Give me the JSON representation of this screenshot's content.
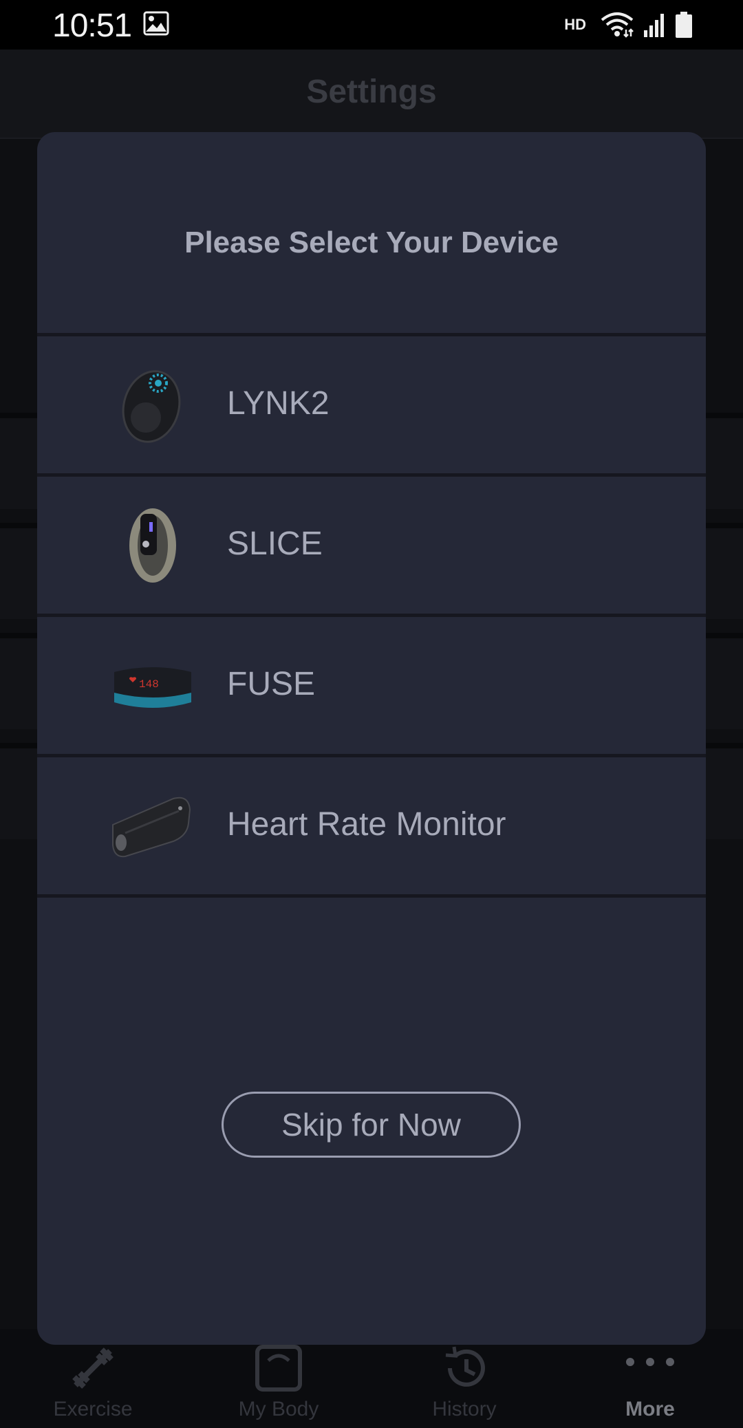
{
  "status_bar": {
    "time": "10:51",
    "network_label": "HD",
    "icons": [
      "image-icon",
      "wifi-icon",
      "signal-icon",
      "battery-icon"
    ]
  },
  "app": {
    "title": "Settings",
    "tabs": [
      {
        "label": "Exercise",
        "icon": "dumbbell-icon"
      },
      {
        "label": "My Body",
        "icon": "scale-icon"
      },
      {
        "label": "History",
        "icon": "history-icon"
      },
      {
        "label": "More",
        "icon": "more-dots-icon",
        "active": true
      }
    ]
  },
  "dialog": {
    "title": "Please Select Your Device",
    "devices": [
      {
        "label": "LYNK2",
        "icon": "lynk2-device-icon"
      },
      {
        "label": "SLICE",
        "icon": "slice-device-icon"
      },
      {
        "label": "FUSE",
        "icon": "fuse-device-icon",
        "display_text": "148"
      },
      {
        "label": "Heart Rate Monitor",
        "icon": "heart-rate-monitor-device-icon"
      }
    ],
    "skip_label": "Skip for Now"
  },
  "colors": {
    "dialog_bg": "#252837",
    "text": "#a8abba",
    "accent_teal": "#2aa6c4"
  }
}
